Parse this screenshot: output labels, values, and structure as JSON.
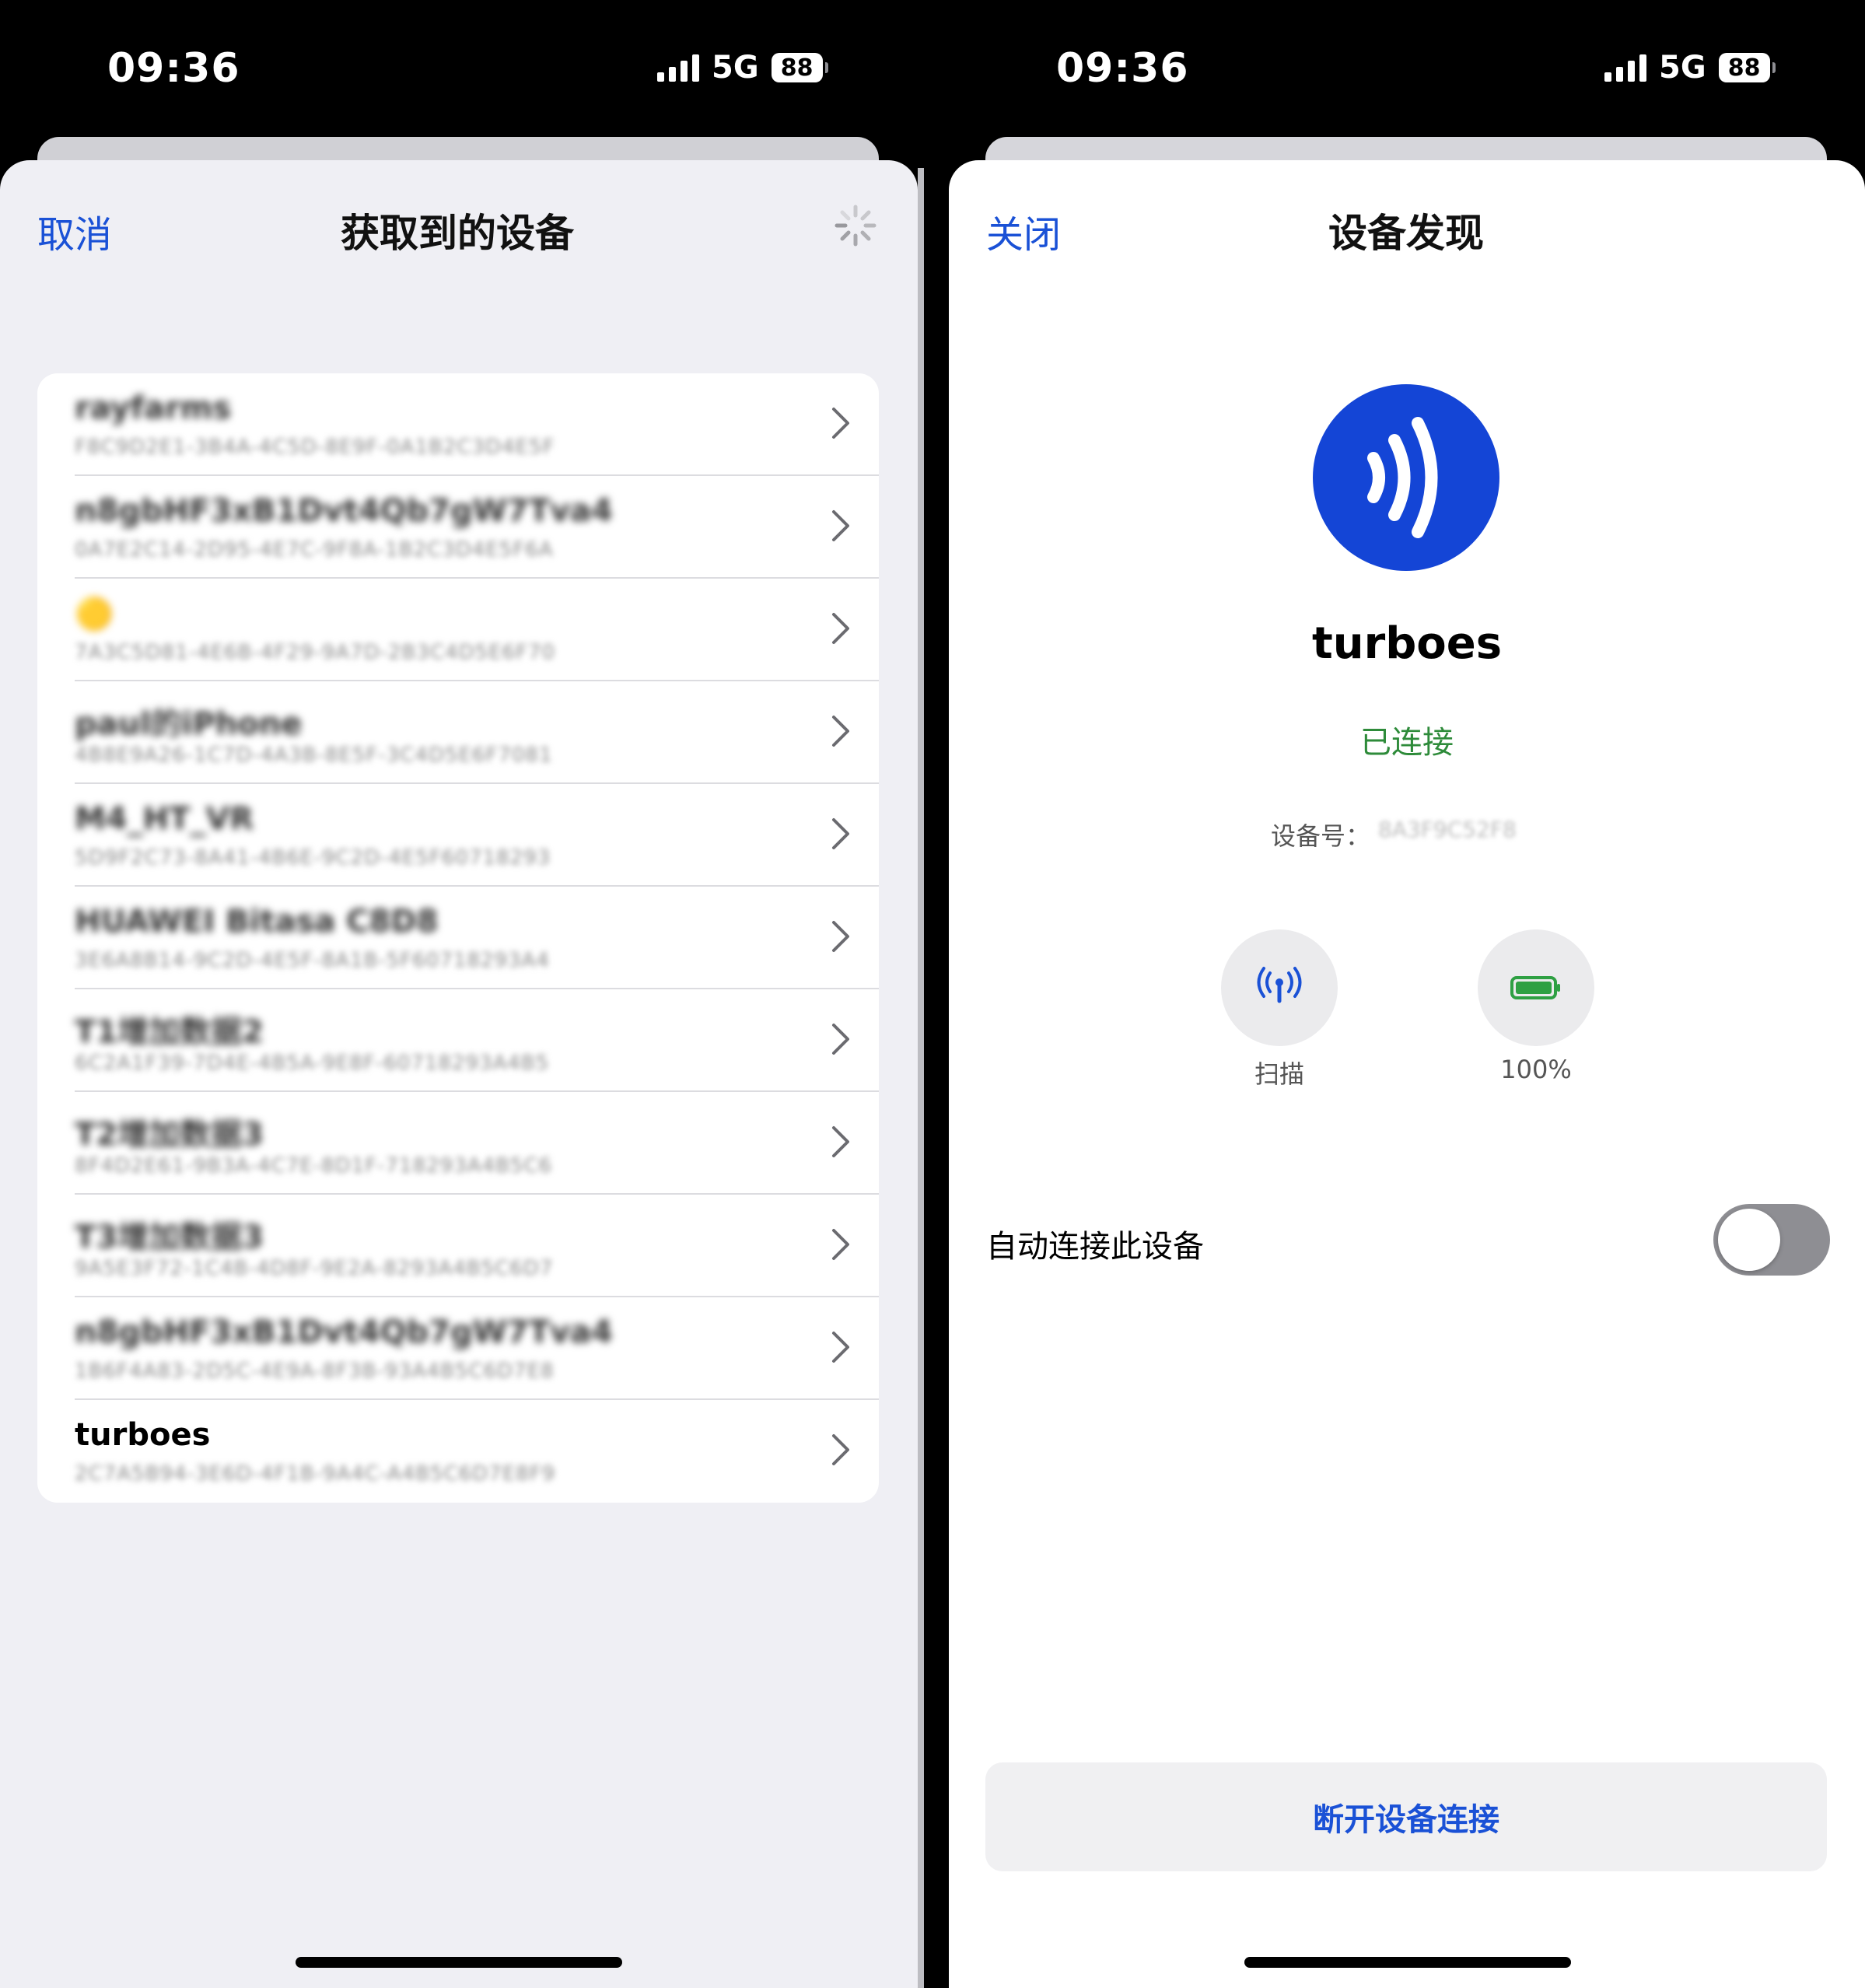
{
  "left_screen": {
    "status_bar": {
      "time": "09:36",
      "network": "5G",
      "battery": "88"
    },
    "nav": {
      "cancel_label": "取消",
      "title": "获取到的设备"
    },
    "devices": [
      {
        "name": "rayfarms",
        "uuid": "F8C9D2E1-3B4A-4C5D-8E9F-0A1B2C3D4E5F"
      },
      {
        "name": "n8gbHF3xB1Dvt4Qb7gW7Tva4",
        "uuid": "0A7E2C14-2D95-4E7C-9F8A-1B2C3D4E5F6A"
      },
      {
        "name": "🟡",
        "uuid": "7A3C5D81-4E6B-4F29-9A7D-2B3C4D5E6F70"
      },
      {
        "name": "paul的iPhone",
        "uuid": "4B8E9A26-1C7D-4A3B-8E5F-3C4D5E6F7081"
      },
      {
        "name": "M4_HT_VR",
        "uuid": "5D9F2C73-8A41-4B6E-9C2D-4E5F60718293"
      },
      {
        "name": "HUAWEI Bitasa C8D8",
        "uuid": "3E6A8B14-9C2D-4E5F-8A1B-5F60718293A4"
      },
      {
        "name": "T1增加数据2",
        "uuid": "6C2A1F39-7D4E-4B5A-9E8F-60718293A4B5"
      },
      {
        "name": "T2增加数据3",
        "uuid": "8F4D2E61-9B3A-4C7E-8D1F-718293A4B5C6"
      },
      {
        "name": "T3增加数据3",
        "uuid": "9A5E3F72-1C4B-4D8F-9E2A-8293A4B5C6D7"
      },
      {
        "name": "n8gbHF3xB1Dvt4Qb7gW7Tva4",
        "uuid": "1B6F4A83-2D5C-4E9A-8F3B-93A4B5C6D7E8"
      },
      {
        "name": "turboes",
        "uuid": "2C7A5B94-3E6D-4F1B-9A4C-A4B5C6D7E8F9"
      }
    ]
  },
  "right_screen": {
    "status_bar": {
      "time": "09:36",
      "network": "5G",
      "battery": "88"
    },
    "nav": {
      "close_label": "关闭",
      "title": "设备发现"
    },
    "device": {
      "name": "turboes",
      "status": "已连接",
      "status_color": "#2e8b3a",
      "device_no_label": "设备号：",
      "device_no_value": "8A3F9C52F8",
      "icon": "nfc-waves-icon",
      "icon_bg": "#1445d6"
    },
    "actions": {
      "scan_label": "扫描",
      "scan_icon": "antenna-icon",
      "battery_label": "100%",
      "battery_icon": "battery-full-icon"
    },
    "auto_connect": {
      "label": "自动连接此设备",
      "enabled": false
    },
    "disconnect_label": "断开设备连接"
  },
  "colors": {
    "accent": "#1a51d6",
    "battery_green": "#2ea043"
  }
}
